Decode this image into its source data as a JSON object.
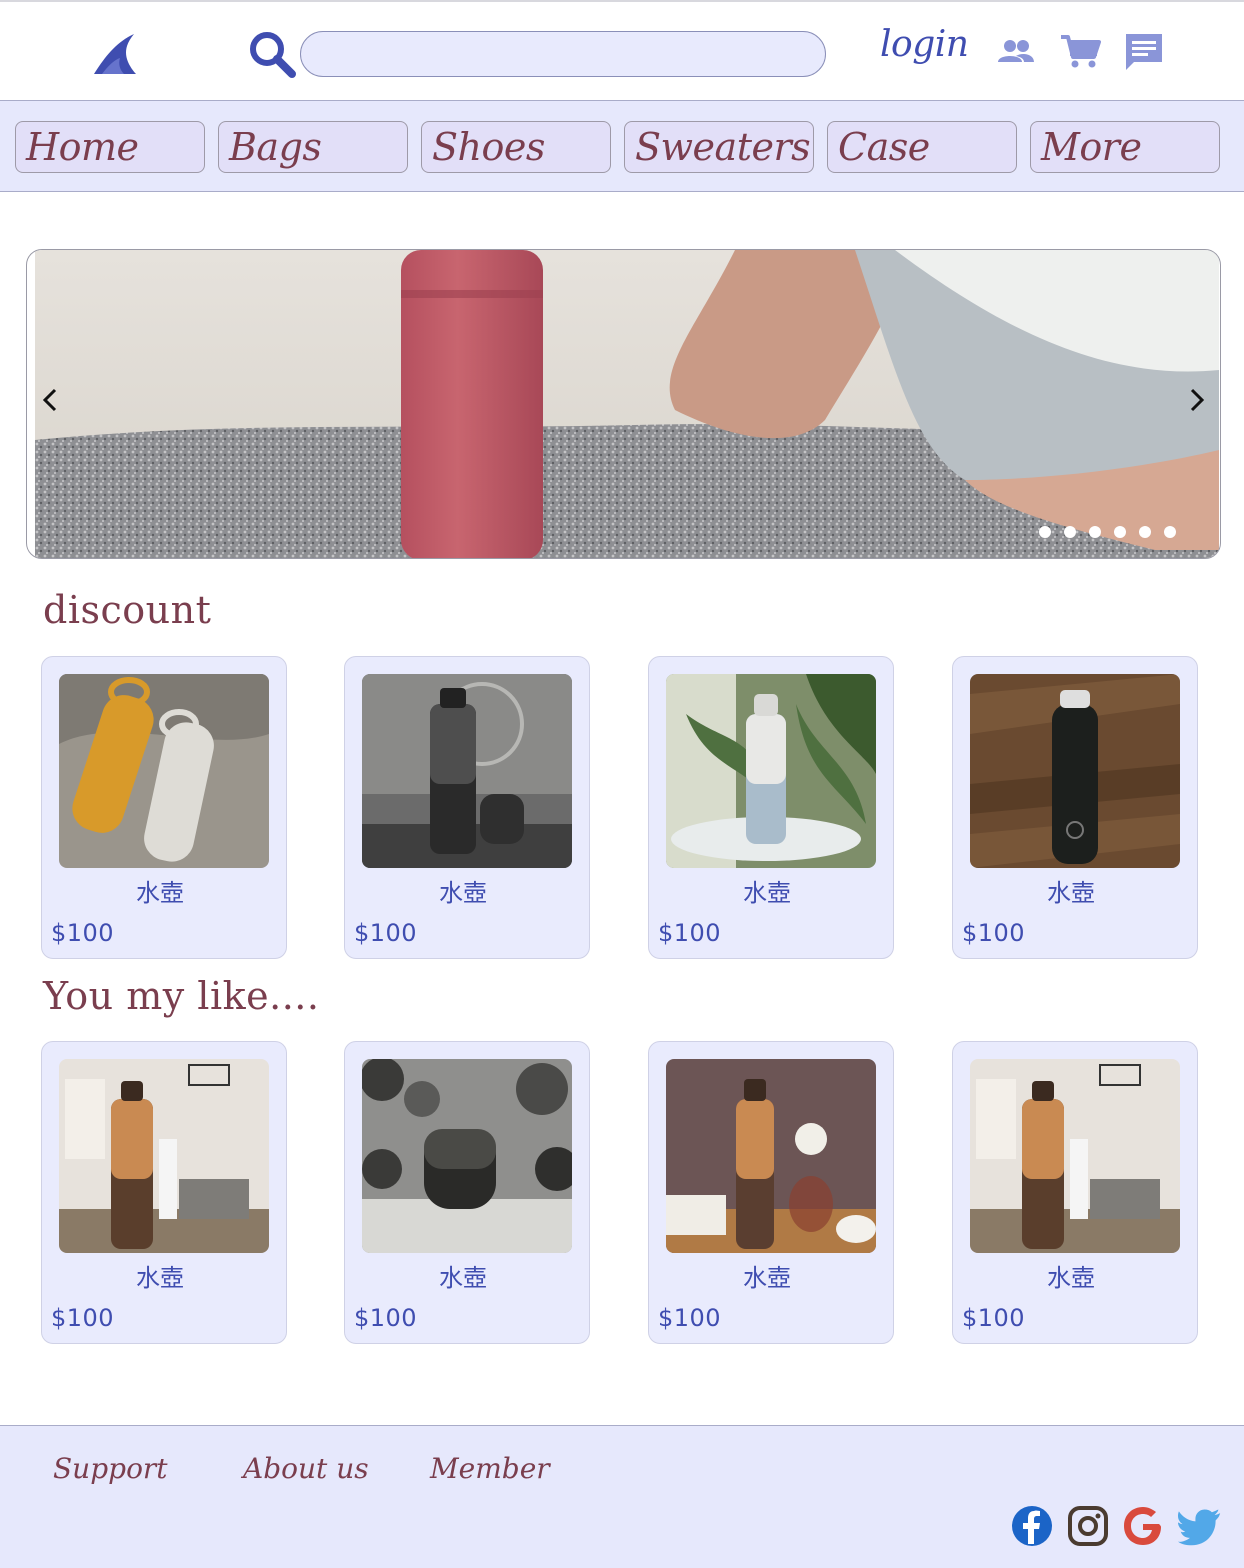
{
  "header": {
    "search": {
      "placeholder": "",
      "value": ""
    },
    "login_label": "login",
    "icons": [
      "logo-icon",
      "search-icon",
      "users-icon",
      "cart-icon",
      "message-icon"
    ]
  },
  "nav": {
    "items": [
      {
        "label": "Home"
      },
      {
        "label": "Bags"
      },
      {
        "label": "Shoes"
      },
      {
        "label": "Sweaters"
      },
      {
        "label": "Case"
      },
      {
        "label": "More"
      }
    ]
  },
  "carousel": {
    "slide_count": 6,
    "active_slide": 1
  },
  "discount": {
    "title": "discount",
    "products": [
      {
        "name": "水壺",
        "price": "$100"
      },
      {
        "name": "水壺",
        "price": "$100"
      },
      {
        "name": "水壺",
        "price": "$100"
      },
      {
        "name": "水壺",
        "price": "$100"
      }
    ]
  },
  "recommend": {
    "title": "You my like....",
    "products": [
      {
        "name": "水壺",
        "price": "$100"
      },
      {
        "name": "水壺",
        "price": "$100"
      },
      {
        "name": "水壺",
        "price": "$100"
      },
      {
        "name": "水壺",
        "price": "$100"
      }
    ]
  },
  "footer": {
    "links": [
      {
        "label": "Support"
      },
      {
        "label": "About us"
      },
      {
        "label": "Member"
      }
    ],
    "social": [
      "facebook-icon",
      "instagram-icon",
      "google-icon",
      "twitter-icon"
    ]
  },
  "colors": {
    "accent": "#3f4db0",
    "title": "#7a3e4e",
    "nav_bg": "#e6e8fc",
    "card_bg": "#e9ebfd"
  }
}
